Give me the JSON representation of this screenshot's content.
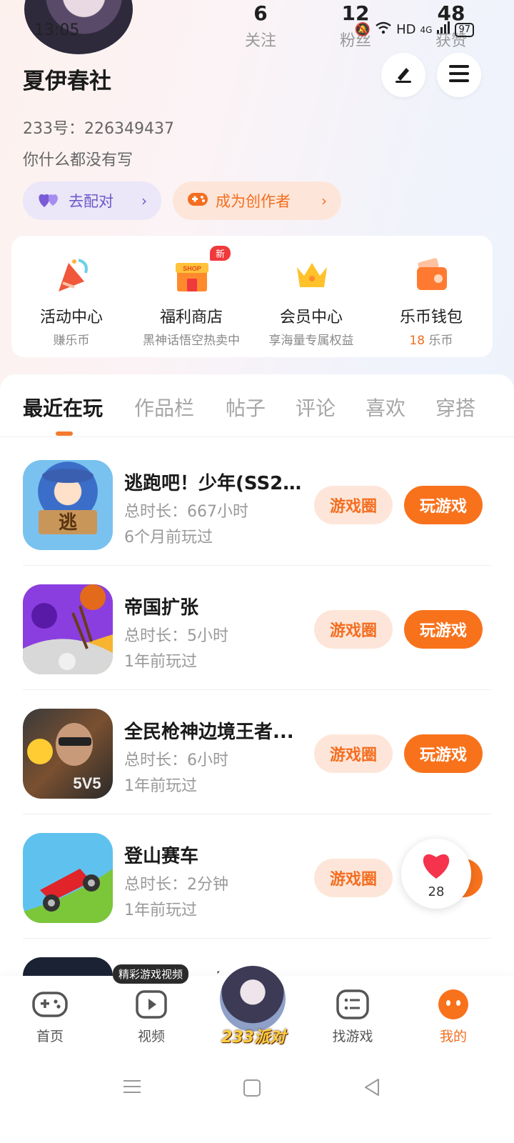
{
  "status_bar": {
    "time": "13:05",
    "network": "HD",
    "signal": "4G",
    "battery": "97"
  },
  "profile": {
    "name": "夏伊春社",
    "uid": "233号：226349437",
    "bio": "你什么都没有写",
    "stats": [
      {
        "value": "6",
        "label": "关注"
      },
      {
        "value": "12",
        "label": "粉丝"
      },
      {
        "value": "48",
        "label": "获赞"
      }
    ],
    "match_label": "去配对",
    "creator_label": "成为创作者"
  },
  "quick_links": [
    {
      "title": "活动中心",
      "subtitle": "赚乐币",
      "icon": "party-popper-icon"
    },
    {
      "title": "福利商店",
      "subtitle": "黑神话悟空热卖中",
      "icon": "shop-icon",
      "badge": "新"
    },
    {
      "title": "会员中心",
      "subtitle": "享海量专属权益",
      "icon": "crown-icon"
    },
    {
      "title": "乐币钱包",
      "subtitle_value": "18",
      "subtitle_unit": "乐币",
      "icon": "wallet-icon"
    }
  ],
  "tabs": [
    "最近在玩",
    "作品栏",
    "帖子",
    "评论",
    "喜欢",
    "穿搭"
  ],
  "games": [
    {
      "name": "逃跑吧！少年(SS2...",
      "playtime": "总时长：667小时",
      "last_played": "6个月前玩过"
    },
    {
      "name": "帝国扩张",
      "playtime": "总时长：5小时",
      "last_played": "1年前玩过"
    },
    {
      "name": "全民枪神边境王者...",
      "playtime": "总时长：6小时",
      "last_played": "1年前玩过"
    },
    {
      "name": "登山赛车",
      "playtime": "总时长：2分钟",
      "last_played": "1年前玩过"
    }
  ],
  "game_circle_label": "游戏圈",
  "play_label": "玩游戏",
  "partial_game_name": "冒张",
  "floating_like": {
    "count": "28"
  },
  "bottom_nav": {
    "tooltip": "精彩游戏视频",
    "items": [
      "首页",
      "视频",
      "找游戏",
      "我的"
    ],
    "center_brand": "233派对"
  },
  "colors": {
    "accent": "#f8721c",
    "accent_light": "#fde6d9",
    "purple": "#6d57c8"
  }
}
